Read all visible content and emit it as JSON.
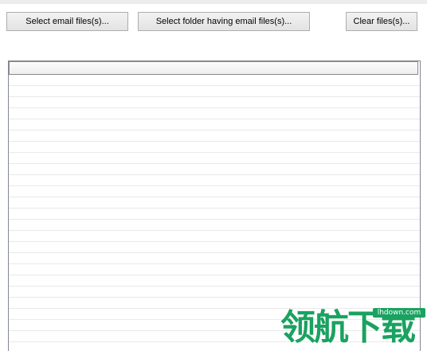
{
  "toolbar": {
    "select_email_label": "Select email files(s)...",
    "select_folder_label": "Select folder having email files(s)...",
    "clear_label": "Clear files(s)..."
  },
  "watermark": {
    "url": "lhdown.com",
    "text": "领航下载"
  },
  "colors": {
    "watermark_green": "#1aa260",
    "button_border": "#adadad",
    "list_border": "#828790",
    "row_line": "#e9e9e9"
  }
}
